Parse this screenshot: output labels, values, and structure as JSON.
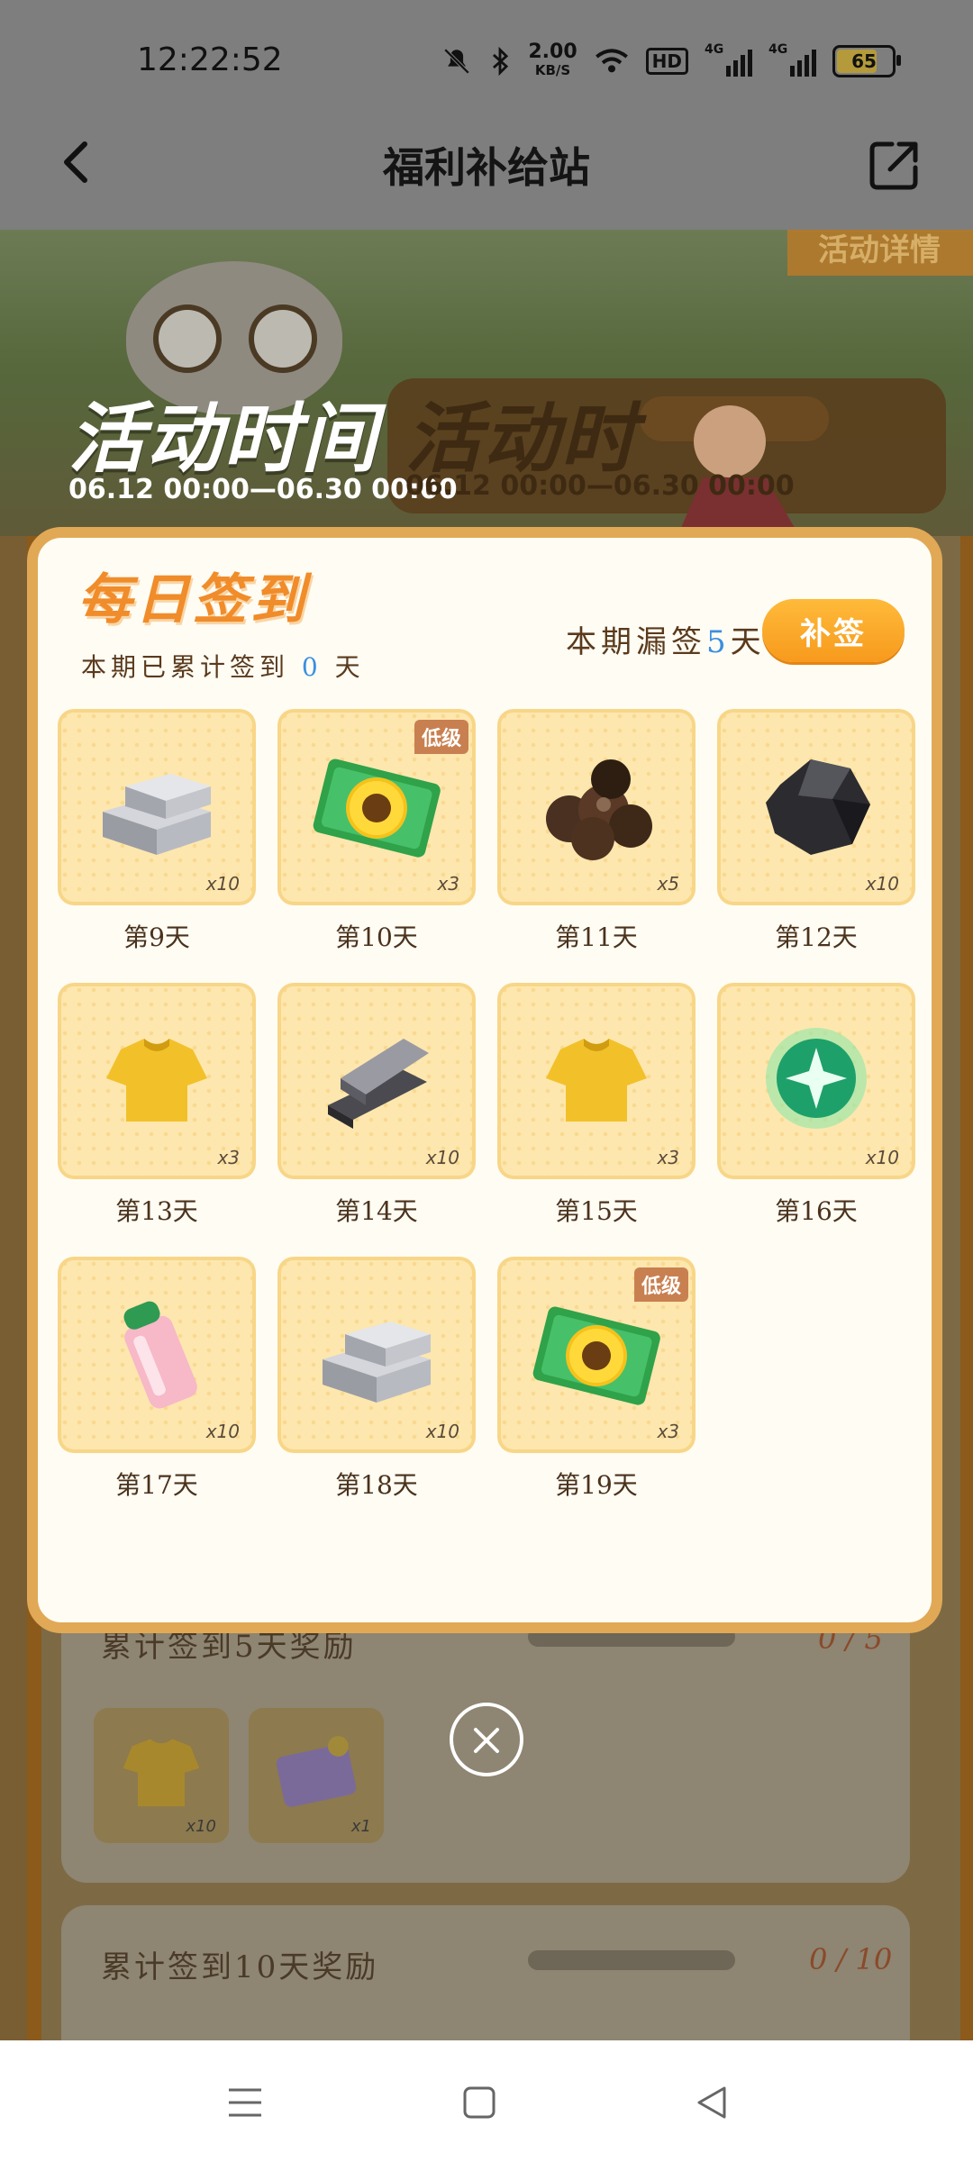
{
  "status_bar": {
    "time": "12:22:52",
    "net_speed_value": "2.00",
    "net_speed_unit": "KB/S",
    "hd_label": "HD",
    "sig1_label": "4G",
    "sig2_label": "4G",
    "battery_level": "65",
    "icons": [
      "mute-bell-icon",
      "bluetooth-icon",
      "wifi-icon",
      "hd-voice-icon",
      "signal-icon",
      "signal-icon",
      "battery-icon"
    ]
  },
  "nav": {
    "title": "福利补给站",
    "back_icon": "chevron-left-icon",
    "share_icon": "share-icon"
  },
  "background": {
    "detail_button": "活动详情",
    "event_time_title": "活动时间",
    "event_time_title_2": "活动时",
    "event_time_range": "06.12 00:00—06.30 00:00",
    "event_time_range_2": "06.12 00:00—06.30 00:00",
    "milestones": [
      {
        "title": "累计签到5天奖励",
        "progress": "0 / 5",
        "progress_fraction": 0,
        "rewards": [
          {
            "icon": "yellow-shirt-icon",
            "count": "x10"
          },
          {
            "icon": "unicorn-card-icon",
            "count": "x1"
          }
        ]
      },
      {
        "title": "累计签到10天奖励",
        "progress": "0 / 10",
        "progress_fraction": 0
      }
    ]
  },
  "modal": {
    "title": "每日签到",
    "signed_prefix": "本期已累计签到",
    "signed_days": "0",
    "signed_suffix": "天",
    "missed_prefix": "本期漏签",
    "missed_days": "5",
    "missed_suffix": "天",
    "resign_button": "补签",
    "days": [
      {
        "label": "第9天",
        "icon": "silver-ingot-icon",
        "count": "x10",
        "tag": ""
      },
      {
        "label": "第10天",
        "icon": "sunflower-ticket-icon",
        "count": "x3",
        "tag": "低级"
      },
      {
        "label": "第11天",
        "icon": "dark-balls-icon",
        "count": "x5",
        "tag": ""
      },
      {
        "label": "第12天",
        "icon": "black-ore-icon",
        "count": "x10",
        "tag": ""
      },
      {
        "label": "第13天",
        "icon": "yellow-shirt-icon",
        "count": "x3",
        "tag": ""
      },
      {
        "label": "第14天",
        "icon": "iron-plate-icon",
        "count": "x10",
        "tag": ""
      },
      {
        "label": "第15天",
        "icon": "yellow-shirt-icon",
        "count": "x3",
        "tag": ""
      },
      {
        "label": "第16天",
        "icon": "green-orb-icon",
        "count": "x10",
        "tag": ""
      },
      {
        "label": "第17天",
        "icon": "pink-bottle-icon",
        "count": "x10",
        "tag": ""
      },
      {
        "label": "第18天",
        "icon": "silver-ingot-icon",
        "count": "x10",
        "tag": ""
      },
      {
        "label": "第19天",
        "icon": "sunflower-ticket-icon",
        "count": "x3",
        "tag": "低级"
      }
    ]
  },
  "close_icon": "close-circle-icon",
  "system_nav": {
    "menu_icon": "menu-icon",
    "home_icon": "home-square-icon",
    "back_icon": "back-triangle-icon"
  }
}
